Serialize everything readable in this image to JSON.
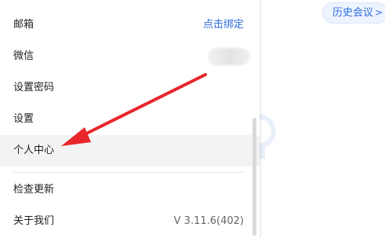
{
  "menu": {
    "items": [
      {
        "label": "邮箱",
        "right": "点击绑定"
      },
      {
        "label": "微信"
      },
      {
        "label": "设置密码"
      },
      {
        "label": "设置"
      },
      {
        "label": "个人中心"
      },
      {
        "label": "检查更新"
      },
      {
        "label": "关于我们",
        "right": "V 3.11.6(402)"
      }
    ]
  },
  "history_button": {
    "label": "历史会议",
    "icon": "chevron-right-icon"
  },
  "annotation": {
    "icon": "red-arrow-icon",
    "color": "#e8262b"
  },
  "colors": {
    "accent": "#2b6de0",
    "active_row": "#f3f3f3"
  }
}
